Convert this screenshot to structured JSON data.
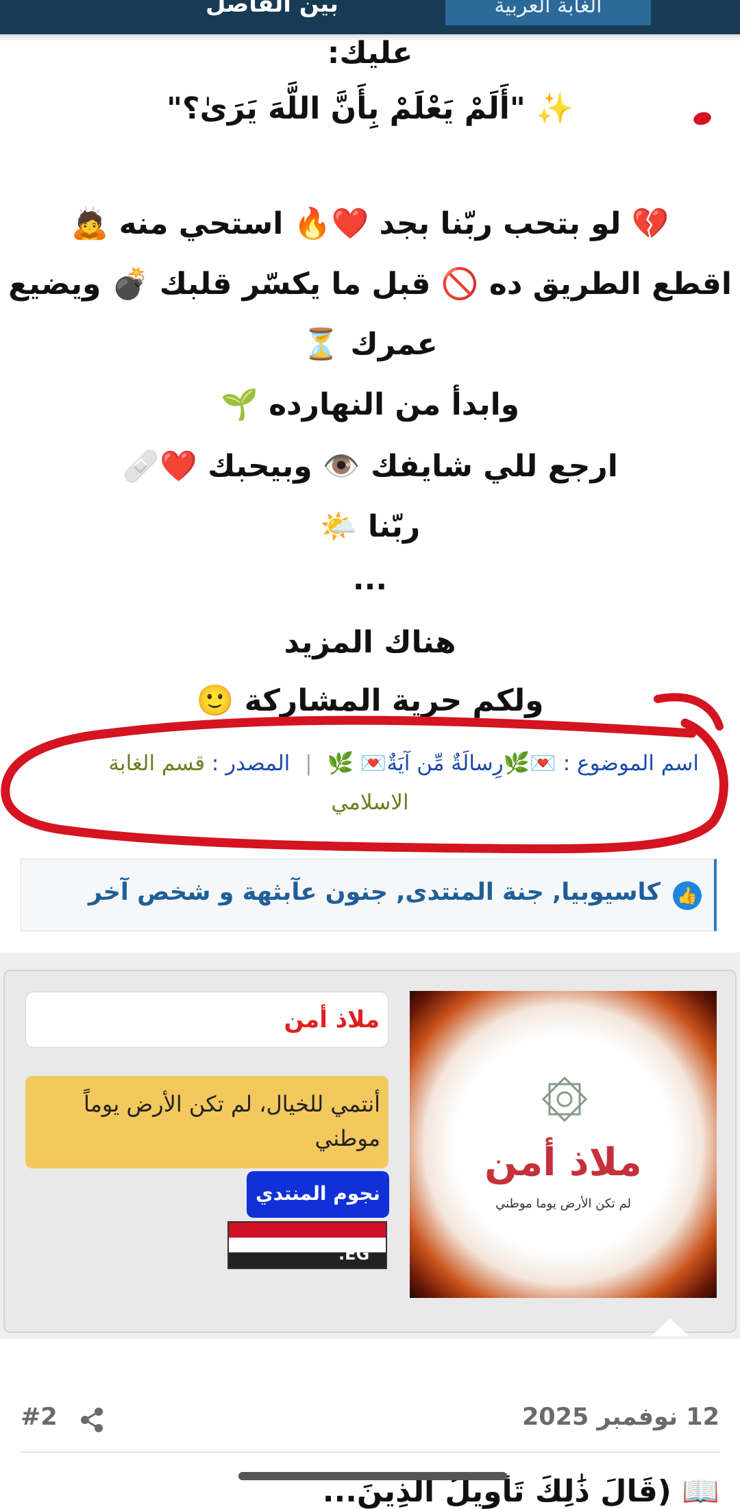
{
  "topbar": {
    "left_text": "بين الفاصل",
    "logo_text": "الغابة العربية"
  },
  "post": {
    "lines": [
      "عليك:",
      "✨ \"أَلَمْ يَعْلَمْ بِأَنَّ اللَّهَ يَرَىٰ؟\"",
      "",
      "💔 لو بتحب ربّنا بجد ❤️🔥 استحي منه 🙇",
      "اقطع الطريق ده 🚫 قبل ما يكسّر قلبك 💣 ويضيع",
      "عمرك ⏳",
      "وابدأ من النهارده 🌱",
      "ارجع للي شايفك 👁️ وبيحبك ❤️🩹",
      "ربّنا 🌤️",
      "...",
      "هناك المزيد",
      "ولكم حرية المشاركة 🙂"
    ]
  },
  "meta": {
    "topic_label": "اسم الموضوع :",
    "topic_value": "💌🌿رِسالَةٌ مِّن آيَةٌ💌 🌿",
    "source_label": "المصدر :",
    "source_value": "قسم الغابة",
    "source_value_2": "الاسلامي"
  },
  "likes": {
    "text": "كاسيوبيا, جنة المنتدى, جنون عآبثهة و شخص آخر"
  },
  "profile": {
    "username": "ملاذ أمن",
    "user_title": "أنتمي للخيال، لم تكن الأرض يوماً موطني",
    "rank_badge": "نجوم المنتدي",
    "flag_code": ".EG",
    "avatar_title": "ملاذ أمن",
    "avatar_subtitle": "لم تكن الأرض يوما موطني"
  },
  "next_post": {
    "date": "12 نوفمبر 2025",
    "number": "#2",
    "preview": "📖 (قَالَ ذَٰلِكَ تَأْوِيلُ الَّذِينَ..."
  },
  "colors": {
    "accent_blue": "#1f5f98",
    "badge_blue": "#1030d8",
    "title_yellow": "#f3c85d",
    "name_red": "#e02020",
    "scribble_red": "#d41420"
  }
}
